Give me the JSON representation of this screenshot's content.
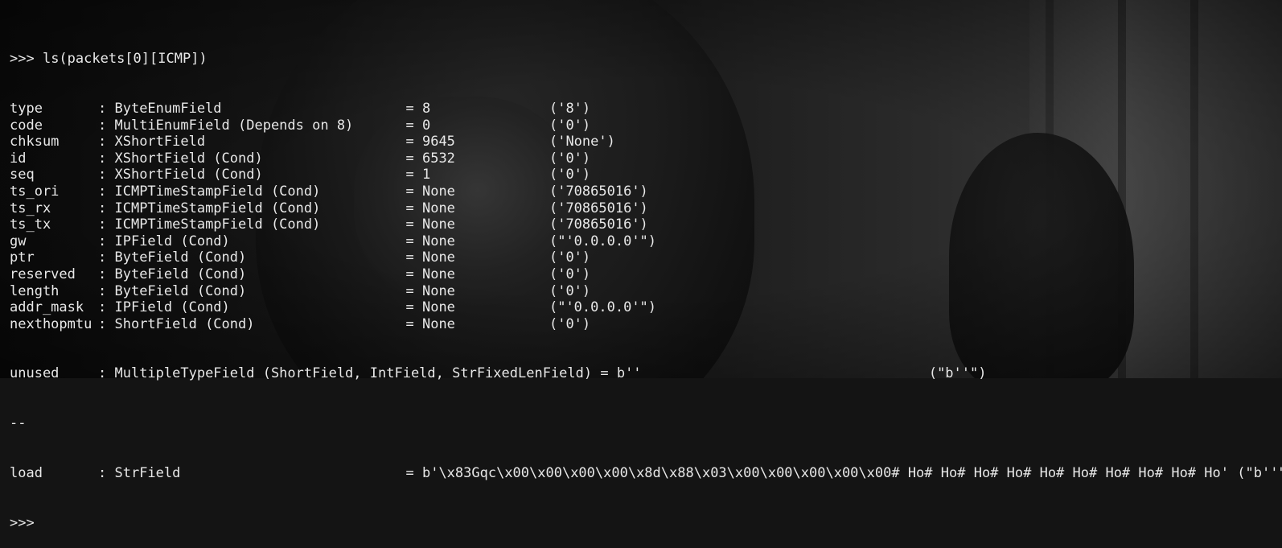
{
  "terminal": {
    "prompt": ">>>",
    "command": " ls(packets[0][ICMP])",
    "separator": "--",
    "fields_main": [
      {
        "name": "type",
        "type": "ByteEnumField",
        "value": "8",
        "default": "('8')"
      },
      {
        "name": "code",
        "type": "MultiEnumField (Depends on 8)",
        "value": "0",
        "default": "('0')"
      },
      {
        "name": "chksum",
        "type": "XShortField",
        "value": "9645",
        "default": "('None')"
      },
      {
        "name": "id",
        "type": "XShortField (Cond)",
        "value": "6532",
        "default": "('0')"
      },
      {
        "name": "seq",
        "type": "XShortField (Cond)",
        "value": "1",
        "default": "('0')"
      },
      {
        "name": "ts_ori",
        "type": "ICMPTimeStampField (Cond)",
        "value": "None",
        "default": "('70865016')"
      },
      {
        "name": "ts_rx",
        "type": "ICMPTimeStampField (Cond)",
        "value": "None",
        "default": "('70865016')"
      },
      {
        "name": "ts_tx",
        "type": "ICMPTimeStampField (Cond)",
        "value": "None",
        "default": "('70865016')"
      },
      {
        "name": "gw",
        "type": "IPField (Cond)",
        "value": "None",
        "default": "(\"'0.0.0.0'\")"
      },
      {
        "name": "ptr",
        "type": "ByteField (Cond)",
        "value": "None",
        "default": "('0')"
      },
      {
        "name": "reserved",
        "type": "ByteField (Cond)",
        "value": "None",
        "default": "('0')"
      },
      {
        "name": "length",
        "type": "ByteField (Cond)",
        "value": "None",
        "default": "('0')"
      },
      {
        "name": "addr_mask",
        "type": "IPField (Cond)",
        "value": "None",
        "default": "(\"'0.0.0.0'\")"
      },
      {
        "name": "nexthopmtu",
        "type": "ShortField (Cond)",
        "value": "None",
        "default": "('0')"
      }
    ],
    "unused_line": {
      "name": "unused",
      "type": "MultipleTypeField (ShortField, IntField, StrFixedLenField)",
      "value": "b''",
      "default": "(\"b''\")"
    },
    "load_line": {
      "name": "load",
      "type": "StrField",
      "value": "b'\\x83Gqc\\x00\\x00\\x00\\x00\\x8d\\x88\\x03\\x00\\x00\\x00\\x00\\x00# Ho# Ho# Ho# Ho# Ho# Ho# Ho# Ho# Ho# Ho'",
      "default": "(\"b''\")"
    },
    "final_prompt": ">>>"
  },
  "colors": {
    "text": "#e8e8e8",
    "background": "#141414"
  }
}
